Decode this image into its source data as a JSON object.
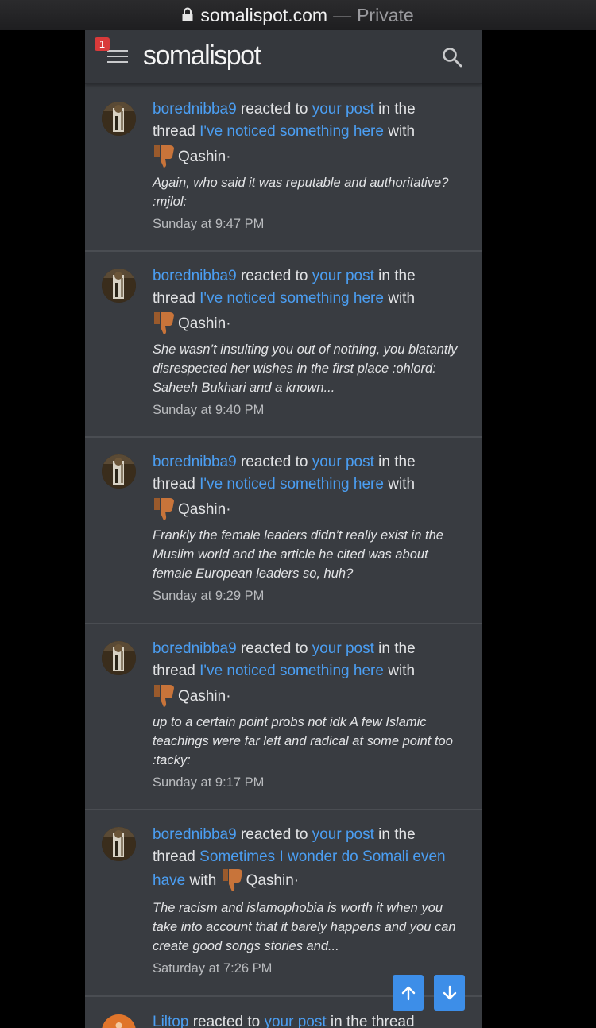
{
  "browser": {
    "domain": "somalispot.com",
    "separator": "—",
    "mode": "Private"
  },
  "header": {
    "notification_count": "1",
    "logo": "somalispot",
    "logo_dot": ".",
    "icons": {
      "menu": "hamburger-icon",
      "search": "search-icon"
    }
  },
  "colors": {
    "link": "#4b9ef2",
    "background": "#393c41",
    "badge": "#d93a3a",
    "scroll_buttons": "#3d8ee8"
  },
  "alerts": [
    {
      "user": "borednibba9",
      "reacted_to": "reacted to",
      "your_post": "your post",
      "in_the_thread": "in the",
      "thread_word": "thread",
      "thread_title": "I've noticed something here",
      "with": "with",
      "reaction": "Qashin",
      "snippet": "Again, who said it was reputable and authoritative? :mjlol:",
      "time": "Sunday at 9:47 PM"
    },
    {
      "user": "borednibba9",
      "reacted_to": "reacted to",
      "your_post": "your post",
      "in_the_thread": "in the",
      "thread_word": "thread",
      "thread_title": "I've noticed something here",
      "with": "with",
      "reaction": "Qashin",
      "snippet": "She wasn’t insulting you out of nothing, you blatantly disrespected her wishes in the first place :ohlord: Saheeh Bukhari and a known...",
      "time": "Sunday at 9:40 PM"
    },
    {
      "user": "borednibba9",
      "reacted_to": "reacted to",
      "your_post": "your post",
      "in_the_thread": "in the",
      "thread_word": "thread",
      "thread_title": "I've noticed something here",
      "with": "with",
      "reaction": "Qashin",
      "snippet": "Frankly the female leaders didn’t really exist in the Muslim world and the article he cited was about female European leaders so, huh?",
      "time": "Sunday at 9:29 PM"
    },
    {
      "user": "borednibba9",
      "reacted_to": "reacted to",
      "your_post": "your post",
      "in_the_thread": "in the",
      "thread_word": "thread",
      "thread_title": "I've noticed something here",
      "with": "with",
      "reaction": "Qashin",
      "snippet": "up to a certain point probs not idk A few Islamic teachings were far left and radical at some point too :tacky:",
      "time": "Sunday at 9:17 PM"
    },
    {
      "user": "borednibba9",
      "reacted_to": "reacted to",
      "your_post": "your post",
      "in_the_thread": "in the",
      "thread_word": "thread",
      "thread_title": "Sometimes I wonder do Somali even have",
      "with": "with",
      "reaction": "Qashin",
      "snippet": "The racism and islamophobia is worth it when you take into account that it barely happens and you can create good songs stories and...",
      "time": "Saturday at 7:26 PM"
    },
    {
      "user": "Liltop",
      "reacted_to": "reacted to",
      "your_post": "your post",
      "in_the_thread_full": "in the thread"
    }
  ],
  "scroll": {
    "up_icon": "arrow-up-icon",
    "down_icon": "arrow-down-icon"
  }
}
